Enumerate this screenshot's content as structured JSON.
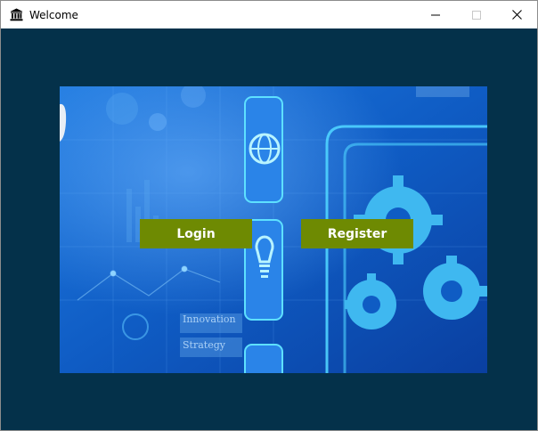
{
  "window": {
    "title": "Welcome",
    "icon": "bank-icon",
    "controls": [
      "minimize-icon",
      "maximize-icon",
      "close-icon"
    ]
  },
  "banner": {
    "image": "technology-innovation-background",
    "labels": [
      "Innovation",
      "Strategy"
    ]
  },
  "buttons": {
    "login_label": "Login",
    "register_label": "Register",
    "color": "#6e8a02"
  },
  "colors": {
    "client_background": "#04314a",
    "banner_blue": "#0f5cc4",
    "glow": "#4fd3ff"
  }
}
